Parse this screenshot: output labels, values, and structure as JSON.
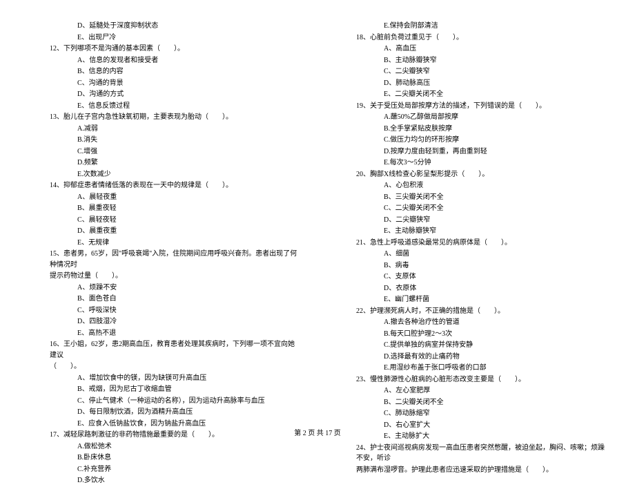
{
  "left_column": [
    {
      "type": "option",
      "text": "D、延髓处于深度抑制状态"
    },
    {
      "type": "option",
      "text": "E、出现尸冷"
    },
    {
      "type": "qhead",
      "text": "12、下列哪项不是沟通的基本因素（　　）。"
    },
    {
      "type": "option",
      "text": "A、信息的发现者和接受者"
    },
    {
      "type": "option",
      "text": "B、信息的内容"
    },
    {
      "type": "option",
      "text": "C、沟通的背景"
    },
    {
      "type": "option",
      "text": "D、沟通的方式"
    },
    {
      "type": "option",
      "text": "E、信息反馈过程"
    },
    {
      "type": "qhead",
      "text": "13、胎儿在子宫内急性缺氧初期，主要表现为胎动（　　）。"
    },
    {
      "type": "option",
      "text": "A.减弱"
    },
    {
      "type": "option",
      "text": "B.消失"
    },
    {
      "type": "option",
      "text": "C.增强"
    },
    {
      "type": "option",
      "text": "D.频繁"
    },
    {
      "type": "option",
      "text": "E.次数减少"
    },
    {
      "type": "qhead",
      "text": "14、抑郁症患者情绪低落的表现在一天中的规律是（　　）。"
    },
    {
      "type": "option",
      "text": "A、晨轻夜重"
    },
    {
      "type": "option",
      "text": "B、晨重夜轻"
    },
    {
      "type": "option",
      "text": "C、晨轻夜轻"
    },
    {
      "type": "option",
      "text": "D、晨重夜重"
    },
    {
      "type": "option",
      "text": "E、无规律"
    },
    {
      "type": "qhead",
      "text": "15、患者男，65岁，因\"呼吸衰竭\"入院，住院期间应用呼吸兴奋剂。患者出现了何种情况时"
    },
    {
      "type": "cont",
      "text": "提示药物过量（　　）。"
    },
    {
      "type": "option",
      "text": "A、烦躁不安"
    },
    {
      "type": "option",
      "text": "B、面色苍白"
    },
    {
      "type": "option",
      "text": "C、呼吸深快"
    },
    {
      "type": "option",
      "text": "D、四肢湿冷"
    },
    {
      "type": "option",
      "text": "E、高热不退"
    },
    {
      "type": "qhead",
      "text": "16、王小姐，62岁，患2期高血压，教育患者处理其疾病时，下列哪一项不宜向她建议"
    },
    {
      "type": "cont",
      "text": "（　　）。"
    },
    {
      "type": "option",
      "text": "A、增加饮食中的镁，因为缺镁可升高血压"
    },
    {
      "type": "option",
      "text": "B、戒烟，因为尼古丁收缩血管"
    },
    {
      "type": "option",
      "text": "C、停止气健术（一种运动的名称），因为运动升高脉率与血压"
    },
    {
      "type": "option",
      "text": "D、每日限制饮酒，因为酒精升高血压"
    },
    {
      "type": "option",
      "text": "E、应食入低钠盐饮食，因为钠盐升高血压"
    },
    {
      "type": "qhead",
      "text": "17、减轻尿路刺激征的非药物措施最重要的是（　　）。"
    },
    {
      "type": "option",
      "text": "A.做松弛术"
    },
    {
      "type": "option",
      "text": "B.卧床休息"
    },
    {
      "type": "option",
      "text": "C.补充营养"
    },
    {
      "type": "option",
      "text": "D.多饮水"
    }
  ],
  "right_column": [
    {
      "type": "option",
      "text": "E.保持会阴部清洁"
    },
    {
      "type": "qhead",
      "text": "18、心脏前负荷过重见于（　　）。"
    },
    {
      "type": "option",
      "text": "A、高血压"
    },
    {
      "type": "option",
      "text": "B、主动脉瓣狭窄"
    },
    {
      "type": "option",
      "text": "C、二尖瓣狭窄"
    },
    {
      "type": "option",
      "text": "D、肺动脉高压"
    },
    {
      "type": "option",
      "text": "E、二尖瓣关闭不全"
    },
    {
      "type": "qhead",
      "text": "19、关于受压处局部按摩方法的描述，下列错误的是（　　）。"
    },
    {
      "type": "option",
      "text": "A.蘸50%乙醇做局部按摩"
    },
    {
      "type": "option",
      "text": "B.全手掌紧贴皮肤按摩"
    },
    {
      "type": "option",
      "text": "C.做压力均匀的环形按摩"
    },
    {
      "type": "option",
      "text": "D.按摩力度由轻到重，再由重到轻"
    },
    {
      "type": "option",
      "text": "E.每次3～5分钟"
    },
    {
      "type": "qhead",
      "text": "20、胸部X线检查心影呈梨形提示（　　）。"
    },
    {
      "type": "option",
      "text": "A、心包积液"
    },
    {
      "type": "option",
      "text": "B、三尖瓣关闭不全"
    },
    {
      "type": "option",
      "text": "C、二尖瓣关闭不全"
    },
    {
      "type": "option",
      "text": "D、二尖瓣狭窄"
    },
    {
      "type": "option",
      "text": "E、主动脉瓣狭窄"
    },
    {
      "type": "qhead",
      "text": "21、急性上呼吸道感染最常见的病原体是（　　）。"
    },
    {
      "type": "option",
      "text": "A、细菌"
    },
    {
      "type": "option",
      "text": "B、病毒"
    },
    {
      "type": "option",
      "text": "C、支原体"
    },
    {
      "type": "option",
      "text": "D、衣原体"
    },
    {
      "type": "option",
      "text": "E、幽门螺杆菌"
    },
    {
      "type": "qhead",
      "text": "22、护理濒死病人时，不正确的措施是（　　）。"
    },
    {
      "type": "option",
      "text": "A.撤去各种治疗性的管道"
    },
    {
      "type": "option",
      "text": "B.每天口腔护理2～3次"
    },
    {
      "type": "option",
      "text": "C.提供单独的病室并保持安静"
    },
    {
      "type": "option",
      "text": "D.选择最有效的止痛药物"
    },
    {
      "type": "option",
      "text": "E.用湿纱布盖于张口呼吸者的口部"
    },
    {
      "type": "qhead",
      "text": "23、慢性肺源性心脏病的心脏形态改变主要是（　　）。"
    },
    {
      "type": "option",
      "text": "A、左心室肥厚"
    },
    {
      "type": "option",
      "text": "B、二尖瓣关闭不全"
    },
    {
      "type": "option",
      "text": "C、肺动脉缩窄"
    },
    {
      "type": "option",
      "text": "D、右心室扩大"
    },
    {
      "type": "option",
      "text": "E、主动脉扩大"
    },
    {
      "type": "qhead",
      "text": "24、护士夜间巡视病房发现一高血压患者突然憋醒，被迫坐起，胸闷、咳嗽；烦躁不安，听诊"
    },
    {
      "type": "cont",
      "text": "两肺满布湿啰音。护理此患者应迅速采取的护理措施是（　　）。"
    }
  ],
  "footer": "第 2 页 共 17 页"
}
